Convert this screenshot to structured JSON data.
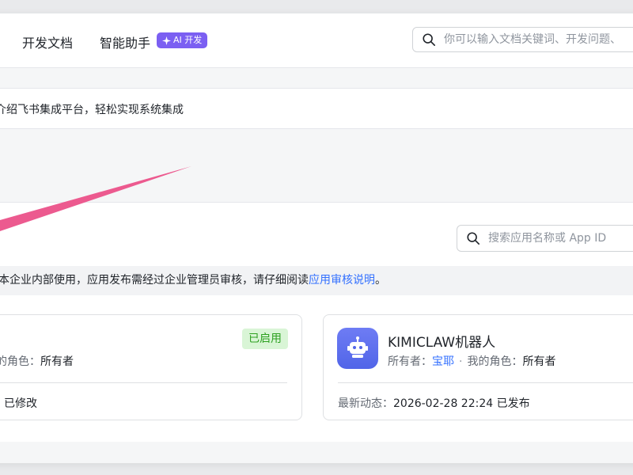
{
  "header": {
    "nav": [
      "开发文档",
      "智能助手"
    ],
    "ai_badge": "AI 开发",
    "search_placeholder": "你可以输入文档关键词、开发问题、"
  },
  "intro": {
    "text": "介绍飞书集成平台，轻松实现系统集成"
  },
  "apps": {
    "search_placeholder": "搜索应用名称或 App ID",
    "notice_text": "本企业内部使用，应用发布需经过企业管理员审核，请仔细阅读",
    "notice_link": "应用审核说明",
    "notice_end": "。",
    "cards": [
      {
        "status": "已启用",
        "role_label": "的角色：",
        "role_value": "所有者",
        "dynamic": "已修改"
      },
      {
        "name": "KIMICLAW机器人",
        "owner_label": "所有者：",
        "owner_name": "宝耶",
        "role_label": "我的角色：",
        "role_value": "所有者",
        "dynamic_label": "最新动态：",
        "dynamic_value": "2026-02-28 22:24 已发布"
      }
    ]
  },
  "colors": {
    "accent": "#3370ff",
    "ai_badge": "#7b5ff2",
    "status_green": "#2ea121",
    "annotation_arrow": "#ec5a8f"
  },
  "icons": [
    "search-icon",
    "sparkle-icon",
    "robot-icon"
  ]
}
